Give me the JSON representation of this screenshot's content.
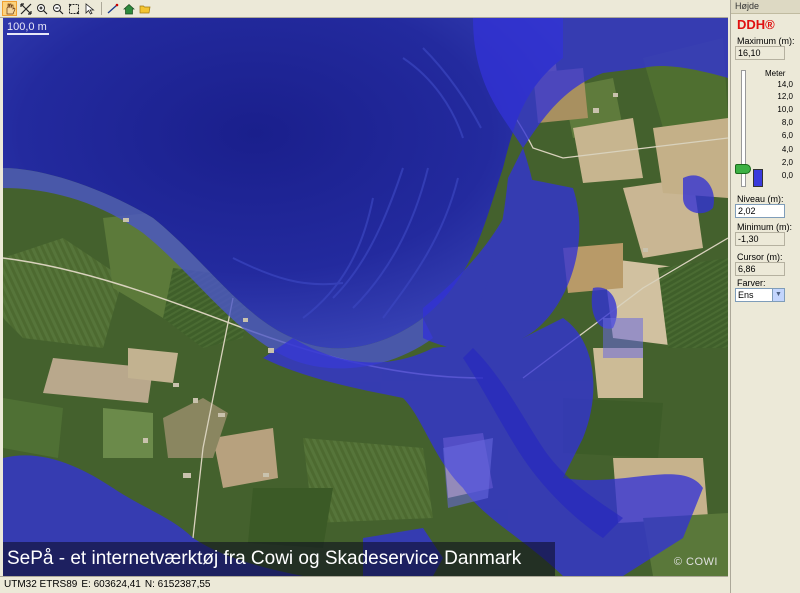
{
  "toolbar": {
    "buttons": [
      "pan-tool",
      "full-extent",
      "zoom-in",
      "zoom-out",
      "zoom-box",
      "select-pointer",
      "measure-line",
      "home",
      "folder"
    ]
  },
  "map": {
    "scale_label": "100,0 m",
    "copyright": "© COWI",
    "banner": "SePå - et internetværktøj fra Cowi og Skadeservice Danmark"
  },
  "statusbar": {
    "crs": "UTM32 ETRS89",
    "east": "E: 603624,41",
    "north": "N: 6152387,55"
  },
  "panel": {
    "title": "Højde",
    "logo": "DDH®",
    "maximum_label": "Maximum (m):",
    "maximum_value": "16,10",
    "meter_label": "Meter",
    "ticks": [
      "14,0",
      "12,0",
      "10,0",
      "8,0",
      "6,0",
      "4,0",
      "2,0",
      "0,0"
    ],
    "niveau_label": "Niveau (m):",
    "niveau_value": "2,02",
    "minimum_label": "Minimum (m):",
    "minimum_value": "-1,30",
    "cursor_label": "Cursor (m):",
    "cursor_value": "6,86",
    "farver_label": "Farver:",
    "farver_value": "Ens",
    "level_fraction": 0.14,
    "flood_color": "#3a3adc"
  }
}
